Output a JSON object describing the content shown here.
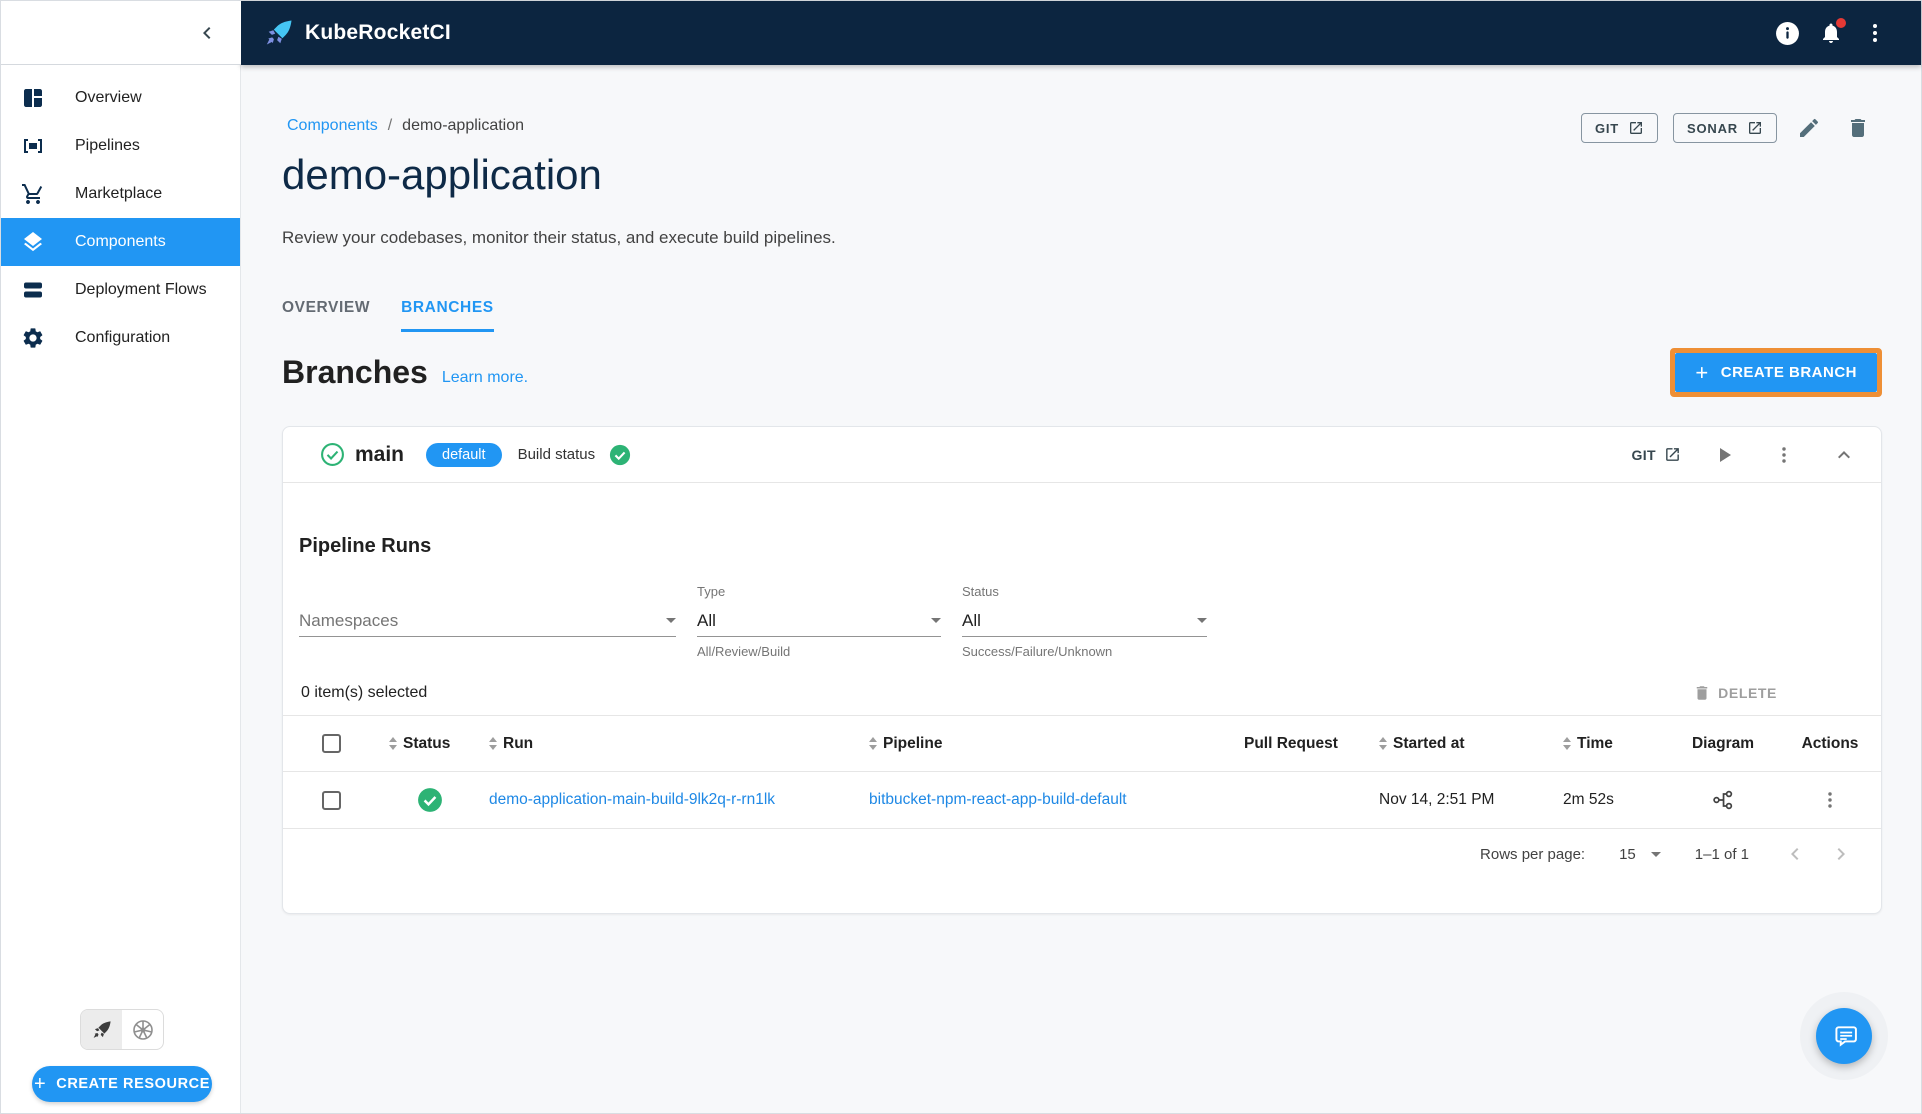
{
  "topbar": {
    "app_title": "KubeRocketCI"
  },
  "sidebar": {
    "items": [
      {
        "label": "Overview",
        "selected": false
      },
      {
        "label": "Pipelines",
        "selected": false
      },
      {
        "label": "Marketplace",
        "selected": false
      },
      {
        "label": "Components",
        "selected": true
      },
      {
        "label": "Deployment Flows",
        "selected": false
      },
      {
        "label": "Configuration",
        "selected": false
      }
    ],
    "create_resource_label": "CREATE RESOURCE"
  },
  "breadcrumb": {
    "parent": "Components",
    "separator": "/",
    "current": "demo-application"
  },
  "page_actions": {
    "git_label": "GIT",
    "sonar_label": "SONAR"
  },
  "page": {
    "title": "demo-application",
    "subtitle": "Review your codebases, monitor their status, and execute build pipelines."
  },
  "tabs": [
    {
      "label": "OVERVIEW",
      "active": false
    },
    {
      "label": "BRANCHES",
      "active": true
    }
  ],
  "branches": {
    "heading": "Branches",
    "learn_more_label": "Learn more.",
    "create_branch_label": "CREATE BRANCH"
  },
  "branch": {
    "name": "main",
    "default_badge": "default",
    "build_status_label": "Build status",
    "git_label": "GIT"
  },
  "pipeline_runs": {
    "heading": "Pipeline Runs",
    "filters": {
      "namespaces_placeholder": "Namespaces",
      "type_label": "Type",
      "type_value": "All",
      "type_helper": "All/Review/Build",
      "status_label": "Status",
      "status_value": "All",
      "status_helper": "Success/Failure/Unknown"
    },
    "selection_text": "0 item(s) selected",
    "delete_label": "DELETE",
    "columns": [
      "Status",
      "Run",
      "Pipeline",
      "Pull Request",
      "Started at",
      "Time",
      "Diagram",
      "Actions"
    ],
    "rows": [
      {
        "status": "success",
        "run": "demo-application-main-build-9lk2q-r-rn1lk",
        "pipeline": "bitbucket-npm-react-app-build-default",
        "pull_request": "",
        "started_at": "Nov 14, 2:51 PM",
        "time": "2m 52s"
      }
    ],
    "pagination": {
      "rows_per_page_label": "Rows per page:",
      "rows_per_page_value": "15",
      "range_text": "1–1 of 1"
    }
  },
  "colors": {
    "accent_blue": "#2196f3",
    "topbar_navy": "#0c2540",
    "success_green": "#2db375",
    "link_blue": "#1e88e5",
    "highlight_orange": "#ee8f35"
  }
}
